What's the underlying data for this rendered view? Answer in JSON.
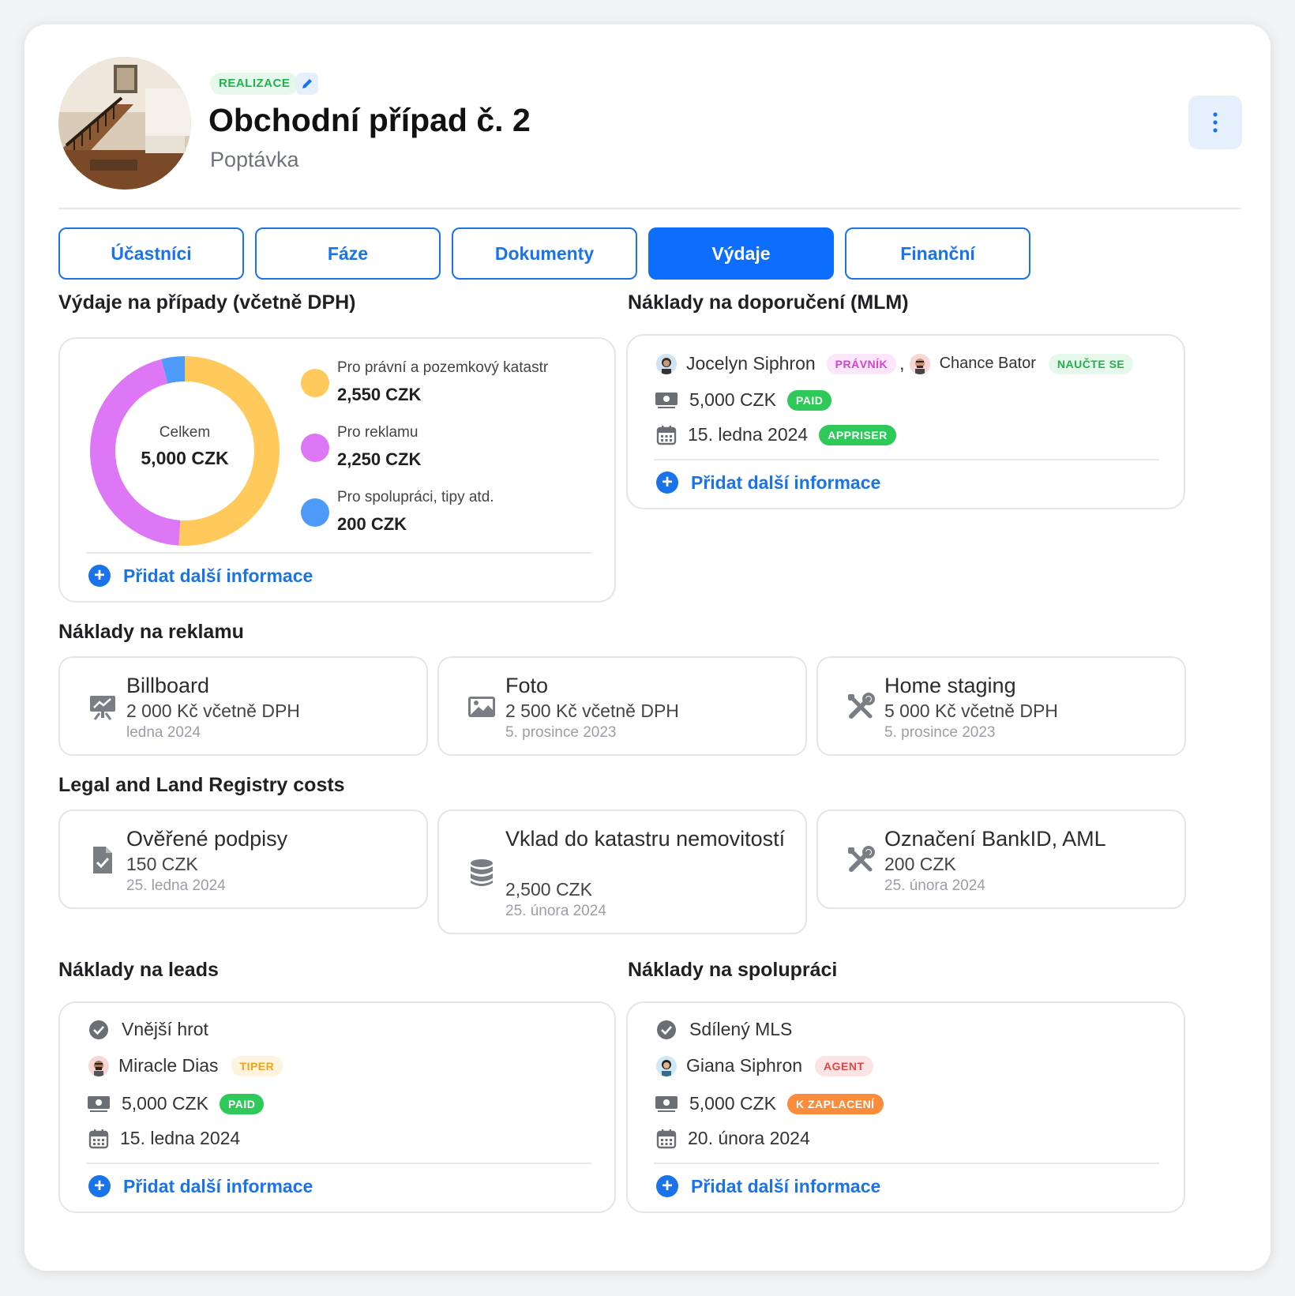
{
  "header": {
    "status": "REALIZACE",
    "title": "Obchodní případ č. 2",
    "subtitle": "Poptávka",
    "more_icon": "more-vertical-icon",
    "edit_icon": "pencil-icon"
  },
  "tabs": [
    {
      "label": "Účastníci",
      "active": false
    },
    {
      "label": "Fáze",
      "active": false
    },
    {
      "label": "Dokumenty",
      "active": false
    },
    {
      "label": "Výdaje",
      "active": true
    },
    {
      "label": "Finanční",
      "active": false
    }
  ],
  "expenses": {
    "heading": "Výdaje na případy (včetně DPH)",
    "center_label": "Celkem",
    "center_value": "5,000 CZK",
    "add_label": "Přidat další informace"
  },
  "chart_data": {
    "type": "pie",
    "categories": [
      "Pro právní a pozemkový katastr",
      "Pro reklamu",
      "Pro spolupráci, tipy atd."
    ],
    "values": [
      2550,
      2250,
      200
    ],
    "value_labels": [
      "2,550 CZK",
      "2,250 CZK",
      "200 CZK"
    ],
    "colors": [
      "#ffc95c",
      "#dd77f6",
      "#4d9af9"
    ],
    "title": "Výdaje na případy (včetně DPH)",
    "donut": true
  },
  "mlm": {
    "heading": "Náklady na doporučení (MLM)",
    "person1": "Jocelyn Siphron",
    "person1_role": "PRÁVNÍK",
    "separator": ",",
    "person2": "Chance Bator",
    "person2_role": "NAUČTE SE",
    "amount": "5,000 CZK",
    "amount_status": "PAID",
    "date": "15. ledna 2024",
    "date_tag": "APPRISER",
    "add_label": "Přidat další informace"
  },
  "advertising": {
    "heading": "Náklady na reklamu",
    "items": [
      {
        "title": "Billboard",
        "amount": "2 000 Kč včetně DPH",
        "date": "ledna 2024",
        "icon": "billboard-icon"
      },
      {
        "title": "Foto",
        "amount": "2 500 Kč včetně DPH",
        "date": "5. prosince 2023",
        "icon": "image-icon"
      },
      {
        "title": "Home staging",
        "amount": "5 000 Kč včetně DPH",
        "date": "5. prosince 2023",
        "icon": "tools-icon"
      }
    ]
  },
  "legal": {
    "heading": "Legal and Land Registry costs",
    "items": [
      {
        "title": "Ověřené podpisy",
        "amount": "150 CZK",
        "date": "25. ledna 2024",
        "icon": "document-check-icon"
      },
      {
        "title": "Vklad do katastru nemovitostí",
        "amount": "2,500 CZK",
        "date": "25. února 2024",
        "icon": "database-icon"
      },
      {
        "title": "Označení BankID, AML",
        "amount": "200 CZK",
        "date": "25. února 2024",
        "icon": "tools-icon"
      }
    ]
  },
  "leads": {
    "heading": "Náklady na leads",
    "source": "Vnější hrot",
    "person": "Miracle Dias",
    "person_role": "TIPER",
    "amount": "5,000 CZK",
    "amount_status": "PAID",
    "date": "15. ledna 2024",
    "add_label": "Přidat další informace"
  },
  "cooperation": {
    "heading": "Náklady na spolupráci",
    "source": "Sdílený MLS",
    "person": "Giana Siphron",
    "person_role": "AGENT",
    "amount": "5,000 CZK",
    "amount_status": "K ZAPLACENÍ",
    "date": "20. února 2024",
    "add_label": "Přidat další informace"
  },
  "colors": {
    "accent": "#0d6efd",
    "link": "#1a73e8",
    "success": "#2fc95a",
    "warning": "#fb8c3c"
  }
}
